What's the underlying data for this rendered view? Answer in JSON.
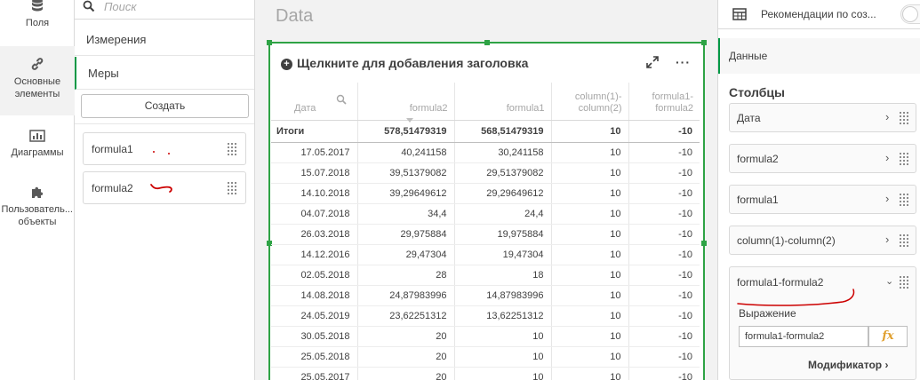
{
  "rail": {
    "fields": "Поля",
    "core_line1": "Основные",
    "core_line2": "элементы",
    "charts": "Диаграммы",
    "custom_line1": "Пользователь...",
    "custom_line2": "объекты"
  },
  "assets": {
    "search_placeholder": "Поиск",
    "dimensions": "Измерения",
    "measures": "Меры",
    "create": "Создать",
    "measure_items": [
      "formula1",
      "formula2"
    ]
  },
  "sheet": {
    "title": "Data",
    "chart_title": "Щелкните для добавления заголовка",
    "more": "···"
  },
  "table": {
    "headers": [
      "Дата",
      "formula2",
      "formula1",
      "column(1)-column(2)",
      "formula1-formula2"
    ],
    "header_lines": [
      [
        "Дата"
      ],
      [
        "formula2"
      ],
      [
        "formula1"
      ],
      [
        "column(1)-",
        "column(2)"
      ],
      [
        "formula1-",
        "formula2"
      ]
    ],
    "totals": [
      "Итоги",
      "578,51479319",
      "568,51479319",
      "10",
      "-10"
    ],
    "rows": [
      [
        "17.05.2017",
        "40,241158",
        "30,241158",
        "10",
        "-10"
      ],
      [
        "15.07.2018",
        "39,51379082",
        "29,51379082",
        "10",
        "-10"
      ],
      [
        "14.10.2018",
        "39,29649612",
        "29,29649612",
        "10",
        "-10"
      ],
      [
        "04.07.2018",
        "34,4",
        "24,4",
        "10",
        "-10"
      ],
      [
        "26.03.2018",
        "29,975884",
        "19,975884",
        "10",
        "-10"
      ],
      [
        "14.12.2016",
        "29,47304",
        "19,47304",
        "10",
        "-10"
      ],
      [
        "02.05.2018",
        "28",
        "18",
        "10",
        "-10"
      ],
      [
        "14.08.2018",
        "24,87983996",
        "14,87983996",
        "10",
        "-10"
      ],
      [
        "24.05.2019",
        "23,62251312",
        "13,62251312",
        "10",
        "-10"
      ],
      [
        "30.05.2018",
        "20",
        "10",
        "10",
        "-10"
      ],
      [
        "25.05.2018",
        "20",
        "10",
        "10",
        "-10"
      ],
      [
        "25.05.2017",
        "20",
        "10",
        "10",
        "-10"
      ]
    ]
  },
  "props": {
    "recommendations": "Рекомендации по соз...",
    "data_tab": "Данные",
    "columns_title": "Столбцы",
    "columns": [
      "Дата",
      "formula2",
      "formula1",
      "column(1)-column(2)"
    ],
    "expanded_column": "formula1-formula2",
    "expression_label": "Выражение",
    "expression_value": "formula1-formula2",
    "fx": "fx",
    "modifier": "Модификатор"
  },
  "colors": {
    "accent_green": "#009845",
    "selection_green": "#2ea345",
    "annotation_red": "#cc0000"
  }
}
